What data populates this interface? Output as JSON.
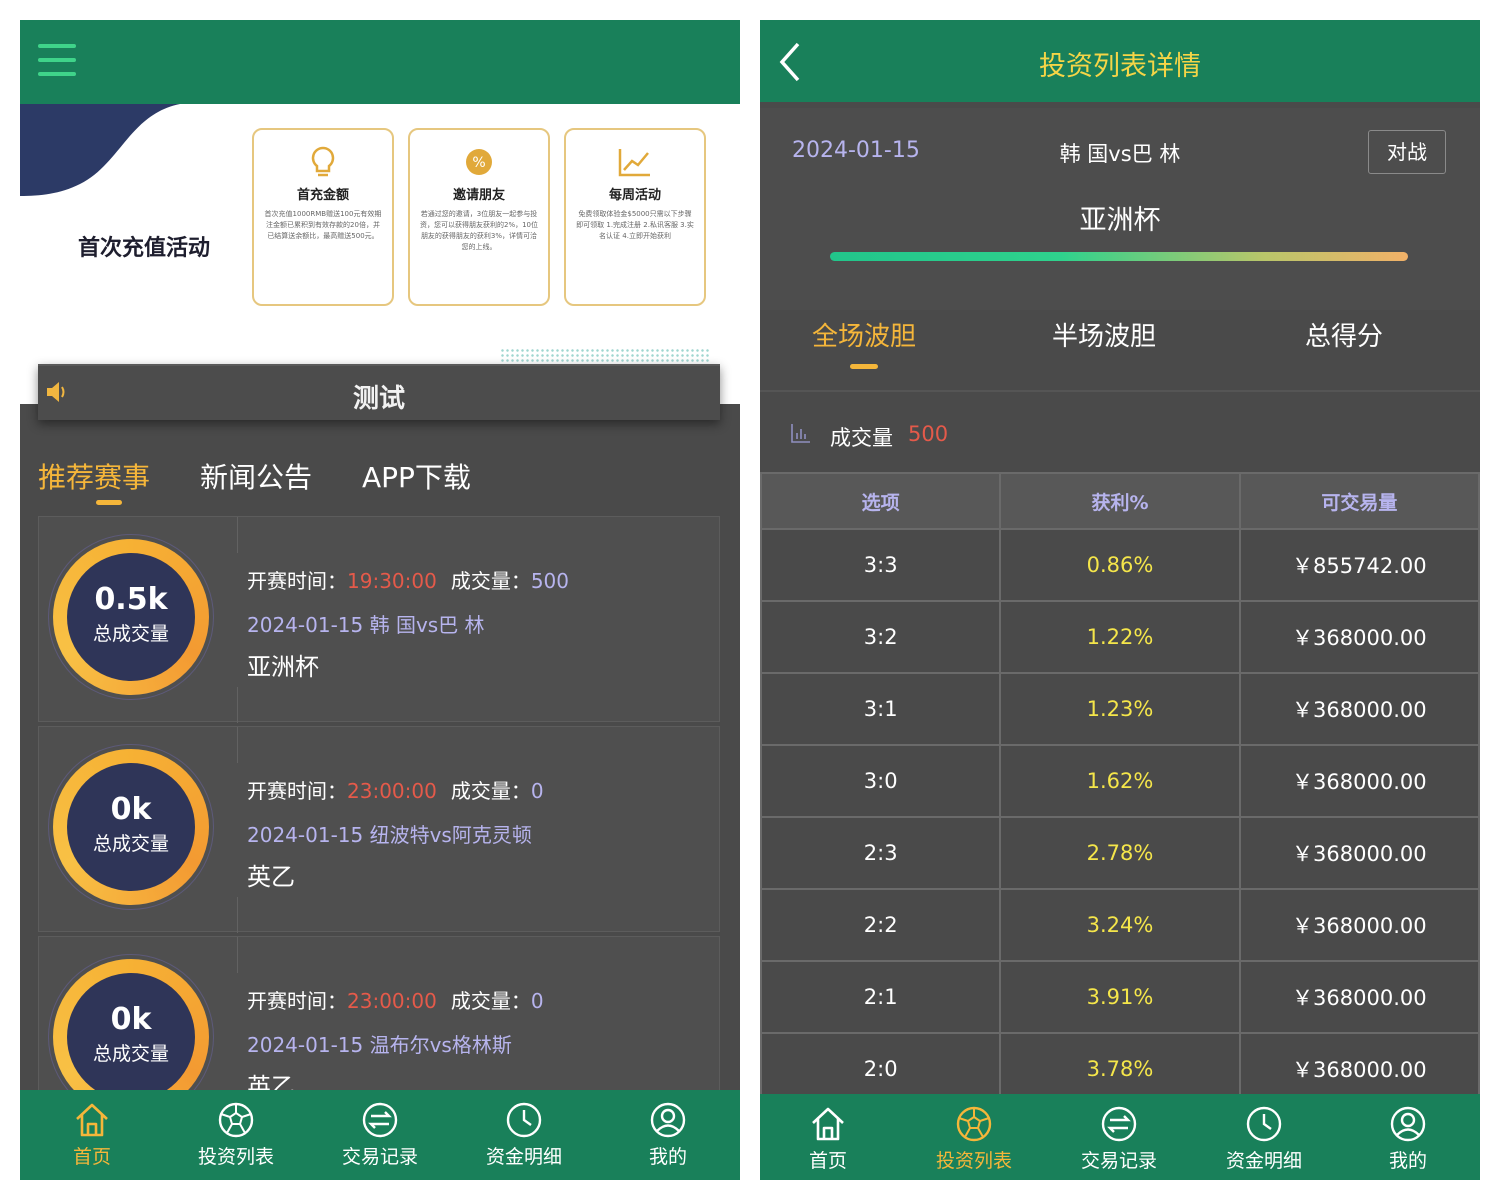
{
  "left": {
    "banner": {
      "title": "首次充值活动",
      "cards": [
        {
          "title": "首充金额",
          "desc": "首次充值1000RMB赠送100元有效期注金额已累积到有效存款的20倍，并已结算送余额比，最高赠送500元。"
        },
        {
          "title": "邀请朋友",
          "desc": "若通过您的邀请，3位朋友一起参与投资，您可以获得朋友获利的2%，10位朋友的获得朋友的获利3%，详情可洽您的上线。"
        },
        {
          "title": "每周活动",
          "desc": "免费领取体验金$5000只需以下步骤即可领取 1.完成注册 2.私讯客服 3.实名认证 4.立即开始获利"
        }
      ]
    },
    "notice": "测试",
    "tabs": [
      "推荐赛事",
      "新闻公告",
      "APP下载"
    ],
    "matches": [
      {
        "ring_value": "0.5k",
        "ring_label": "总成交量",
        "time_label": "开赛时间：",
        "time": "19:30:00",
        "vol_label": "成交量：",
        "vol": "500",
        "teams": "2024-01-15 韩 国vs巴 林",
        "league": "亚洲杯"
      },
      {
        "ring_value": "0k",
        "ring_label": "总成交量",
        "time_label": "开赛时间：",
        "time": "23:00:00",
        "vol_label": "成交量：",
        "vol": "0",
        "teams": "2024-01-15 纽波特vs阿克灵顿",
        "league": "英乙"
      },
      {
        "ring_value": "0k",
        "ring_label": "总成交量",
        "time_label": "开赛时间：",
        "time": "23:00:00",
        "vol_label": "成交量：",
        "vol": "0",
        "teams": "2024-01-15 温布尔vs格林斯",
        "league": "英乙"
      }
    ],
    "tabbar": [
      "首页",
      "投资列表",
      "交易记录",
      "资金明细",
      "我的"
    ]
  },
  "right": {
    "title": "投资列表详情",
    "date": "2024-01-15",
    "teams": "韩 国vs巴 林",
    "battle_button": "对战",
    "league": "亚洲杯",
    "tabs": [
      "全场波胆",
      "半场波胆",
      "总得分"
    ],
    "volume_label": "成交量",
    "volume_value": "500",
    "table": {
      "headers": [
        "选项",
        "获利%",
        "可交易量"
      ],
      "rows": [
        [
          "3:3",
          "0.86%",
          "￥855742.00"
        ],
        [
          "3:2",
          "1.22%",
          "￥368000.00"
        ],
        [
          "3:1",
          "1.23%",
          "￥368000.00"
        ],
        [
          "3:0",
          "1.62%",
          "￥368000.00"
        ],
        [
          "2:3",
          "2.78%",
          "￥368000.00"
        ],
        [
          "2:2",
          "3.24%",
          "￥368000.00"
        ],
        [
          "2:1",
          "3.91%",
          "￥368000.00"
        ],
        [
          "2:0",
          "3.78%",
          "￥368000.00"
        ]
      ]
    },
    "tabbar": [
      "首页",
      "投资列表",
      "交易记录",
      "资金明细",
      "我的"
    ]
  },
  "colors": {
    "header_green": "#19805a",
    "accent_orange": "#f5b63a",
    "profit_yellow": "#f5e64a",
    "time_red": "#e55a4a",
    "link_purple": "#b7b4ee",
    "bg_dark": "#4a4a4a"
  }
}
